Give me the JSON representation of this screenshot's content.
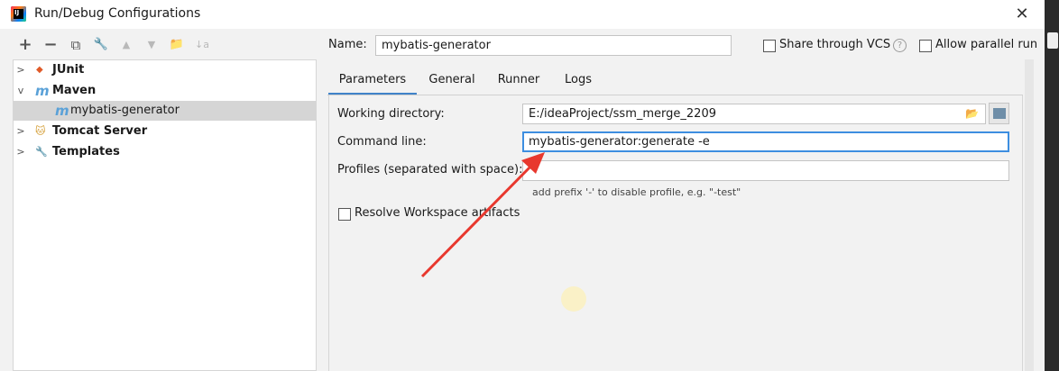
{
  "window": {
    "title": "Run/Debug Configurations",
    "app_icon_text": "IJ",
    "close_glyph": "✕"
  },
  "toolbar": {
    "add": "+",
    "remove": "−",
    "copy": "⧉",
    "edit": "🔧",
    "up": "▲",
    "down": "▼",
    "folder": "📁",
    "sort": "↓a"
  },
  "tree": {
    "items": [
      {
        "label": "JUnit",
        "icon": "junit-icon",
        "glyph": "◆",
        "color": "#e05a28",
        "expanded": false
      },
      {
        "label": "Maven",
        "icon": "maven-icon",
        "glyph": "m",
        "color": "#5aa1d8",
        "expanded": true
      },
      {
        "label": "mybatis-generator",
        "icon": "maven-icon",
        "glyph": "m",
        "color": "#5aa1d8",
        "selected": true
      },
      {
        "label": "Tomcat Server",
        "icon": "tomcat-icon",
        "glyph": "🐱",
        "color": "#d29a2e",
        "expanded": false
      },
      {
        "label": "Templates",
        "icon": "wrench-icon",
        "glyph": "🔧",
        "color": "#333333",
        "expanded": false
      }
    ]
  },
  "header": {
    "name_label": "Name:",
    "name_value": "mybatis-generator",
    "share_label": "Share through VCS",
    "help_glyph": "?",
    "parallel_label": "Allow parallel run"
  },
  "tabs": [
    {
      "label": "Parameters",
      "active": true
    },
    {
      "label": "General"
    },
    {
      "label": "Runner"
    },
    {
      "label": "Logs"
    }
  ],
  "form": {
    "working_dir_label": "Working directory:",
    "working_dir_value": "E:/ideaProject/ssm_merge_2209",
    "command_line_label": "Command line:",
    "command_line_value": "mybatis-generator:generate -e",
    "profiles_label": "Profiles (separated with space):",
    "profiles_value": "",
    "profiles_hint": "add prefix '-' to disable profile, e.g. \"-test\"",
    "resolve_workspace_label": "Resolve Workspace artifacts"
  },
  "colors": {
    "accent": "#4083c9",
    "selection": "#d5d5d5",
    "annotation_arrow": "#e8382e"
  }
}
